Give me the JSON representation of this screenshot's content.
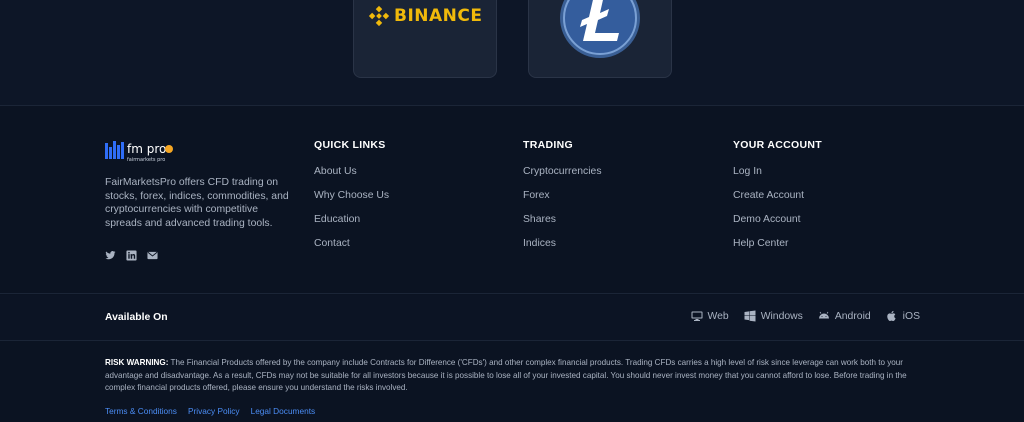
{
  "exchanges": [
    {
      "name": "BINANCE",
      "logo": "binance-logo",
      "color": "#f0b90b"
    },
    {
      "name": "Litecoin",
      "logo": "litecoin-logo",
      "color": "#345d9d"
    }
  ],
  "brand": {
    "logo_text": "fm pro",
    "logo_subtext": "fairmarkets pro",
    "description": "FairMarketsPro offers CFD trading on stocks, forex, indices, commodities, and cryptocurrencies with competitive spreads and advanced trading tools.",
    "socials": [
      "twitter-icon",
      "linkedin-icon",
      "email-icon"
    ]
  },
  "columns": [
    {
      "title": "QUICK LINKS",
      "links": [
        "About Us",
        "Why Choose Us",
        "Education",
        "Contact"
      ]
    },
    {
      "title": "TRADING",
      "links": [
        "Cryptocurrencies",
        "Forex",
        "Shares",
        "Indices"
      ]
    },
    {
      "title": "YOUR ACCOUNT",
      "links": [
        "Log In",
        "Create Account",
        "Demo Account",
        "Help Center"
      ]
    }
  ],
  "available": {
    "label": "Available On",
    "platforms": [
      {
        "label": "Web",
        "icon": "monitor-icon"
      },
      {
        "label": "Windows",
        "icon": "windows-icon"
      },
      {
        "label": "Android",
        "icon": "android-icon"
      },
      {
        "label": "iOS",
        "icon": "apple-icon"
      }
    ]
  },
  "risk": {
    "heading": "RISK WARNING:",
    "text": " The Financial Products offered by the company include Contracts for Difference ('CFDs') and other complex financial products. Trading CFDs carries a high level of risk since leverage can work both to your advantage and disadvantage. As a result, CFDs may not be suitable for all investors because it is possible to lose all of your invested capital. You should never invest money that you cannot afford to lose. Before trading in the complex financial products offered, please ensure you understand the risks involved."
  },
  "legal_links": [
    "Terms & Conditions",
    "Privacy Policy",
    "Legal Documents"
  ],
  "colors": {
    "background": "#0b1322",
    "accent_link": "#4b8df5",
    "brand_blue": "#2f6df6",
    "brand_orange": "#f5a623"
  }
}
